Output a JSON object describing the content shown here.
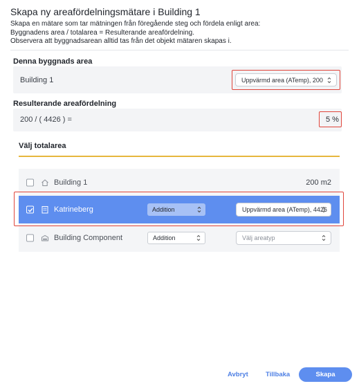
{
  "dialog": {
    "title": "Skapa ny areafördelningsmätare i Building 1",
    "description": [
      "Skapa en mätare som tar mätningen från föregående steg och fördela enligt area:",
      "Byggnadens area / totalarea = Resulterande areafördelning.",
      "Observera att byggnadsarean alltid tas från det objekt mätaren skapas i."
    ]
  },
  "building_area": {
    "label": "Denna byggnads area",
    "name": "Building 1",
    "area_type_selected": "Uppvärmd area (ATemp), 200"
  },
  "result": {
    "label": "Resulterande areafördelning",
    "formula": "200 / ( 4426 ) =",
    "value": "5 %"
  },
  "total_area": {
    "tab_label": "Välj totalarea",
    "rows": [
      {
        "name": "Building 1",
        "checked": false,
        "icon": "home-icon",
        "value": "200 m2"
      },
      {
        "name": "Katrineberg",
        "checked": true,
        "icon": "building-icon",
        "operation": "Addition",
        "area_type": "Uppvärmd area (ATemp), 4426"
      },
      {
        "name": "Building Component",
        "checked": false,
        "icon": "component-icon",
        "operation": "Addition",
        "area_type_placeholder": "Välj areatyp"
      }
    ]
  },
  "footer": {
    "cancel": "Avbryt",
    "back": "Tillbaka",
    "create": "Skapa"
  },
  "colors": {
    "accent": "#5e8eef",
    "highlight_border": "#e0443a",
    "tab_underline": "#e7b73d"
  }
}
